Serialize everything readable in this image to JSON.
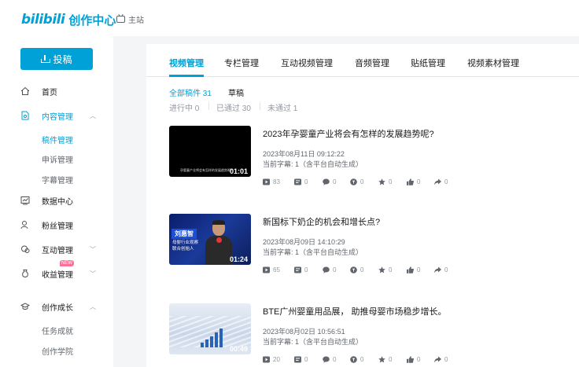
{
  "header": {
    "brand": "bilibili",
    "title": "创作中心",
    "home_link": "主站"
  },
  "sidebar": {
    "upload_label": "投稿",
    "items": [
      {
        "label": "首页",
        "icon": "home-icon"
      },
      {
        "label": "内容管理",
        "icon": "file-edit-icon",
        "active": true
      },
      {
        "label": "数据中心",
        "icon": "chart-icon"
      },
      {
        "label": "粉丝管理",
        "icon": "user-icon"
      },
      {
        "label": "互动管理",
        "icon": "chat-icon"
      },
      {
        "label": "收益管理",
        "icon": "money-bag-icon",
        "badge": "NEW"
      },
      {
        "label": "创作成长",
        "icon": "graduation-cap-icon"
      }
    ],
    "content_sub": [
      "稿件管理",
      "申诉管理",
      "字幕管理"
    ],
    "growth_sub": [
      "任务成就",
      "创作学院"
    ]
  },
  "tabs": [
    "视频管理",
    "专栏管理",
    "互动视频管理",
    "音频管理",
    "贴纸管理",
    "视频素材管理"
  ],
  "filters": {
    "primary": [
      "全部稿件 31",
      "草稿"
    ],
    "status": [
      "进行中 0",
      "已通过 30",
      "未通过 1"
    ]
  },
  "videos": [
    {
      "title": "2023年孕婴童产业将会有怎样的发展趋势呢?",
      "date": "2023年08月11日 09:12:22",
      "subtitle": "当前字幕: 1（含平台自动生成）",
      "duration": "01:01",
      "thumb_caption": "孕婴童产业将会有怎样的发展趋势呢？",
      "plays": "83",
      "danmaku": "0",
      "comments": "0",
      "coins": "0",
      "favorites": "0",
      "likes": "0",
      "shares": "0"
    },
    {
      "title": "新国标下奶企的机会和增长点?",
      "date": "2023年08月09日 14:10:29",
      "subtitle": "当前字幕: 1（含平台自动生成）",
      "duration": "01:24",
      "thumb_name": "刘惠智",
      "thumb_line1": "母婴行业观察",
      "thumb_line2": "联合创始人",
      "plays": "65",
      "danmaku": "0",
      "comments": "0",
      "coins": "0",
      "favorites": "0",
      "likes": "0",
      "shares": "0"
    },
    {
      "title": "BTE广州婴童用品展， 助推母婴市场稳步增长。",
      "date": "2023年08月02日 10:56:51",
      "subtitle": "当前字幕: 1（含平台自动生成）",
      "duration": "00:49",
      "plays": "20",
      "danmaku": "0",
      "comments": "0",
      "coins": "0",
      "favorites": "0",
      "likes": "0",
      "shares": "0"
    }
  ],
  "colors": {
    "accent": "#00a1d6",
    "badge": "#fb7299"
  }
}
